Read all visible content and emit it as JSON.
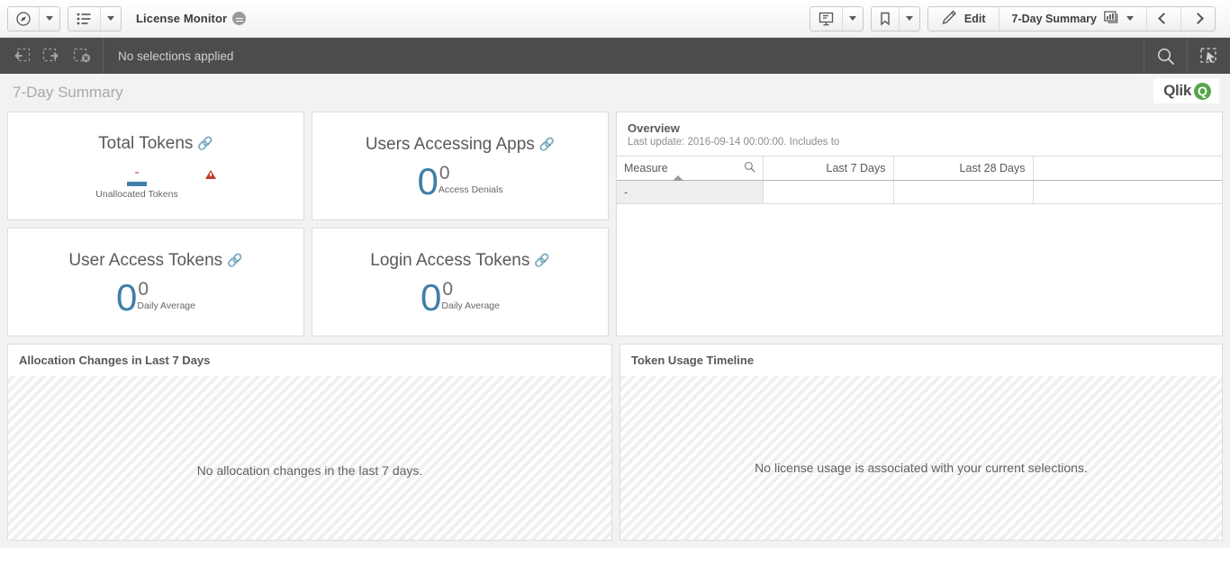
{
  "toolbar": {
    "nav_icon": "compass-icon",
    "sheets_icon": "list-icon",
    "app_title": "License Monitor",
    "story_icon": "storytelling-icon",
    "bookmark_icon": "bookmark-icon",
    "edit_icon": "pencil-icon",
    "edit_label": "Edit",
    "sheet_label": "7-Day Summary",
    "sheet_icon": "sheet-chart-icon",
    "prev_icon": "chevron-left-icon",
    "next_icon": "chevron-right-icon"
  },
  "selection_bar": {
    "undo_icon": "step-back-icon",
    "redo_icon": "step-forward-icon",
    "clear_icon": "clear-selections-icon",
    "status": "No selections applied",
    "search_icon": "search-icon",
    "selections_tool_icon": "selections-tool-icon"
  },
  "sheet": {
    "title": "7-Day Summary",
    "logo_word": "Qlik",
    "logo_mark": "Q"
  },
  "kpis": [
    {
      "title": "Total Tokens",
      "link_icon": "link-icon",
      "value_main": "-",
      "value_secondary": "-",
      "subtitle": "Unallocated Tokens",
      "warning_icon": "warning-triangle-icon",
      "main_color": "#3f7fa8",
      "secondary_color": "#c0504d",
      "warning_color": "#c0392b"
    },
    {
      "title": "Users Accessing Apps",
      "link_icon": "link-icon",
      "value_main": "0",
      "value_secondary": "0",
      "subtitle": "Access Denials",
      "main_color": "#3f7fa8",
      "secondary_color": "#6e6e6e"
    },
    {
      "title": "User Access Tokens",
      "link_icon": "link-icon",
      "value_main": "0",
      "value_secondary": "0",
      "subtitle": "Daily Average",
      "main_color": "#3f7fa8",
      "secondary_color": "#6e6e6e"
    },
    {
      "title": "Login Access Tokens",
      "link_icon": "link-icon",
      "value_main": "0",
      "value_secondary": "0",
      "subtitle": "Daily Average",
      "main_color": "#3f7fa8",
      "secondary_color": "#6e6e6e"
    }
  ],
  "overview": {
    "title": "Overview",
    "subtitle": "Last update: 2016-09-14 00:00:00. Includes to",
    "search_icon": "search-icon",
    "sort_icon": "sort-ascending-icon",
    "columns": [
      "Measure",
      "Last 7 Days",
      "Last 28 Days",
      ""
    ],
    "rows": [
      [
        "-",
        "",
        "",
        ""
      ]
    ]
  },
  "allocation_panel": {
    "title": "Allocation Changes in Last 7 Days",
    "empty_message": "No allocation changes in the last 7 days."
  },
  "timeline_panel": {
    "title": "Token Usage Timeline",
    "empty_message": "No license usage is associated with your current selections."
  }
}
